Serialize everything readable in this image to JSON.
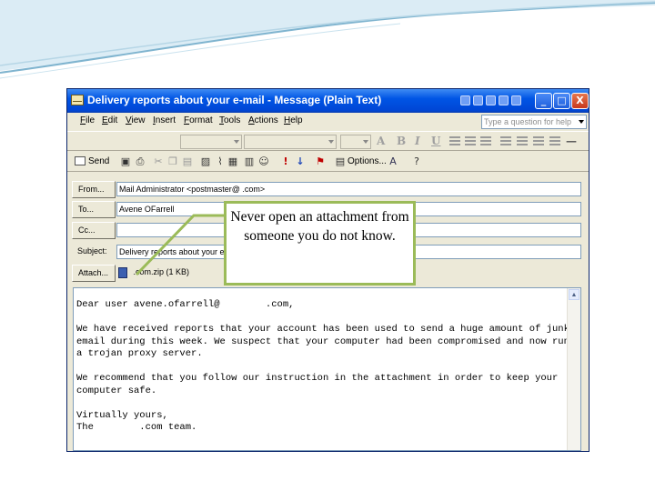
{
  "window": {
    "title": "Delivery reports about your e-mail - Message (Plain Text)",
    "controls": {
      "minimize": "_",
      "maximize": "□",
      "close": "X"
    }
  },
  "menu": {
    "items": [
      "File",
      "Edit",
      "View",
      "Insert",
      "Format",
      "Tools",
      "Actions",
      "Help"
    ],
    "ask_placeholder": "Type a question for help"
  },
  "toolbar": {
    "send_label": "Send",
    "options_label": "Options..."
  },
  "headers": {
    "from_label": "From...",
    "from_value": "Mail Administrator <postmaster@               .com>",
    "to_label": "To...",
    "to_value": "Avene OFarrell",
    "cc_label": "Cc...",
    "cc_value": "",
    "subject_label": "Subject:",
    "subject_value": "Delivery reports about your e-m",
    "attach_label": "Attach...",
    "attach_value": "          .com.zip (1 KB)"
  },
  "message": {
    "lines": [
      "Dear user avene.ofarrell@        .com,",
      "",
      "We have received reports that your account has been used to send a huge amount of junk",
      "email during this week. We suspect that your computer had been compromised and now runs",
      "a trojan proxy server.",
      "",
      "We recommend that you follow our instruction in the attachment in order to keep your",
      "computer safe.",
      "",
      "Virtually yours,",
      "The        .com team."
    ]
  },
  "callout": {
    "text": "Never open an attachment from someone you do not know."
  },
  "colors": {
    "title_bar": "#0055e5",
    "callout_border": "#9bbb59",
    "slide_wave": "#7fb4cf"
  }
}
